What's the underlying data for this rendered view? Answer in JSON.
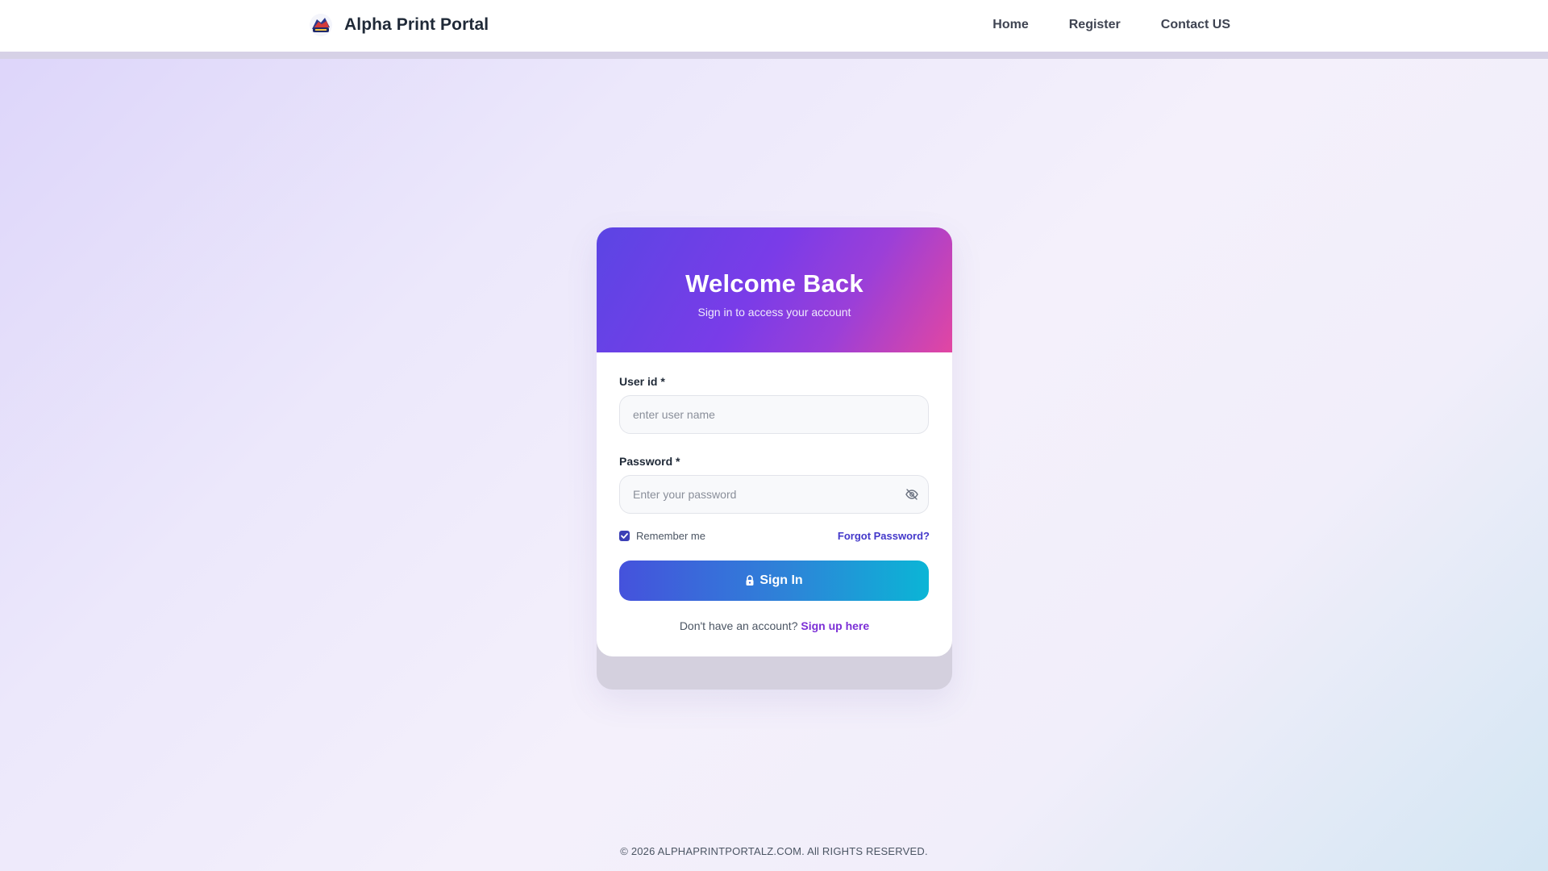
{
  "header": {
    "brand": "Alpha Print Portal",
    "logo_icon": "alpha-logo-icon",
    "nav": [
      {
        "label": "Home"
      },
      {
        "label": "Register"
      },
      {
        "label": "Contact US"
      }
    ]
  },
  "card": {
    "title": "Welcome Back",
    "subtitle": "Sign in to access your account",
    "user_field": {
      "label": "User id *",
      "placeholder": "enter user name",
      "value": ""
    },
    "password_field": {
      "label": "Password *",
      "placeholder": "Enter your password",
      "value": "",
      "toggle_icon": "eye-off-icon"
    },
    "remember": {
      "label": "Remember me",
      "checked": true
    },
    "forgot_label": "Forgot Password?",
    "signin_label": "Sign In",
    "signin_icon": "lock-icon",
    "signup_prompt": "Don't have an account?",
    "signup_link": "Sign up here"
  },
  "footer": {
    "copyright": "© 2026 ALPHAPRINTPORTALZ.COM. All RIGHTS RESERVED."
  },
  "colors": {
    "accent": "#4338ca",
    "header_gradient_start": "#5b45e4",
    "header_gradient_end": "#e246a2",
    "button_gradient_start": "#4552dc",
    "button_gradient_end": "#0bb5d6",
    "signup_link": "#7c2fd6"
  }
}
